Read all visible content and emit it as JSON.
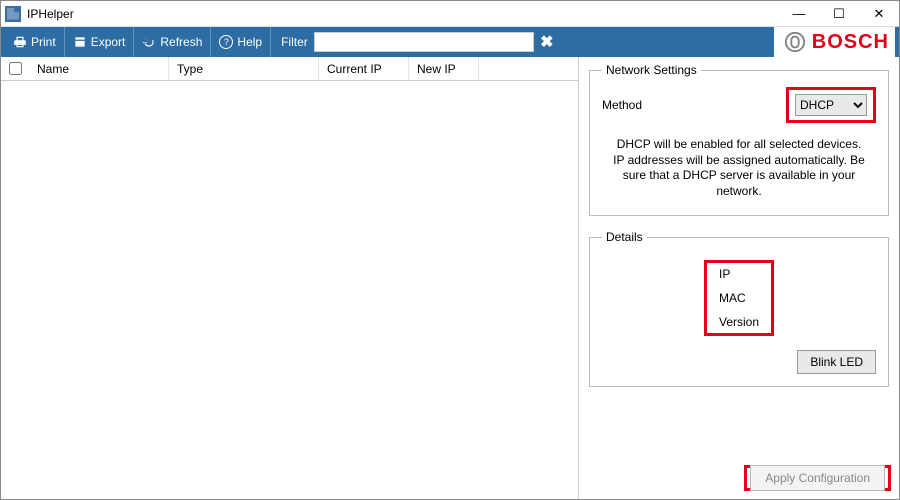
{
  "window": {
    "title": "IPHelper"
  },
  "win_controls": {
    "min": "—",
    "max": "☐",
    "close": "✕"
  },
  "toolbar": {
    "print": "Print",
    "export": "Export",
    "refresh": "Refresh",
    "help": "Help",
    "filter_label": "Filter",
    "filter_value": ""
  },
  "brand": {
    "name": "BOSCH"
  },
  "grid": {
    "columns": {
      "name": "Name",
      "type": "Type",
      "current_ip": "Current IP",
      "new_ip": "New IP"
    }
  },
  "network_settings": {
    "legend": "Network Settings",
    "method_label": "Method",
    "method_value": "DHCP",
    "method_options": [
      "DHCP"
    ],
    "message": "DHCP will be enabled for all selected devices. IP addresses will be assigned automatically. Be sure that a DHCP server is available in your network."
  },
  "details": {
    "legend": "Details",
    "ip_label": "IP",
    "mac_label": "MAC",
    "version_label": "Version",
    "blink_led": "Blink LED"
  },
  "apply": {
    "label": "Apply Configuration"
  }
}
